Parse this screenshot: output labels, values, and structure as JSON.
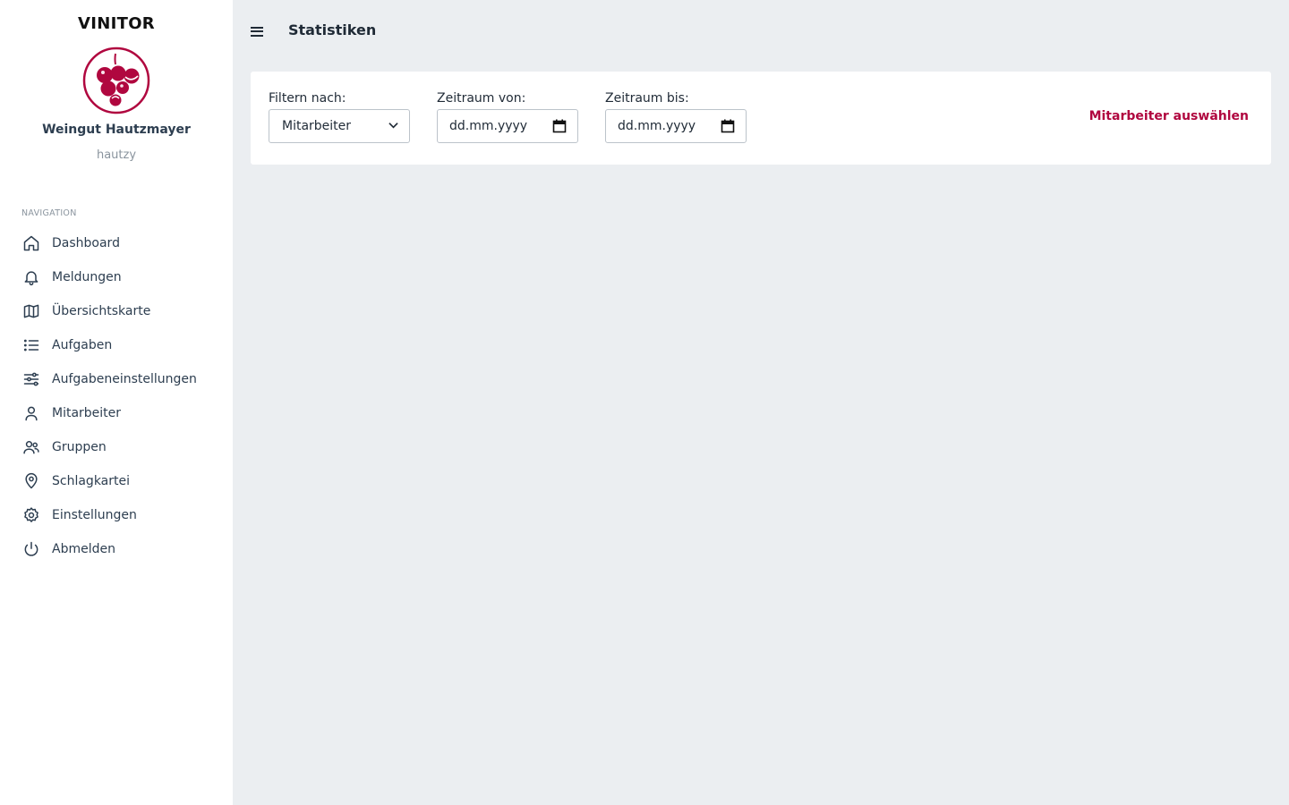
{
  "sidebar": {
    "app_name": "VINITOR",
    "company": "Weingut Hautzmayer",
    "username": "hautzy",
    "nav_title": "NAVIGATION",
    "items": [
      {
        "label": "Dashboard",
        "icon": "home-icon"
      },
      {
        "label": "Meldungen",
        "icon": "bell-icon"
      },
      {
        "label": "Übersichtskarte",
        "icon": "map-icon"
      },
      {
        "label": "Aufgaben",
        "icon": "list-icon"
      },
      {
        "label": "Aufgabeneinstellungen",
        "icon": "sliders-icon"
      },
      {
        "label": "Mitarbeiter",
        "icon": "user-icon"
      },
      {
        "label": "Gruppen",
        "icon": "users-icon"
      },
      {
        "label": "Schlagkartei",
        "icon": "map-pin-icon"
      },
      {
        "label": "Einstellungen",
        "icon": "gear-icon"
      },
      {
        "label": "Abmelden",
        "icon": "power-icon"
      }
    ]
  },
  "header": {
    "title": "Statistiken"
  },
  "filters": {
    "filter_by_label": "Filtern nach:",
    "filter_by_value": "Mitarbeiter",
    "from_label": "Zeitraum von:",
    "from_value": "dd.mm.yyyy",
    "to_label": "Zeitraum bis:",
    "to_value": "dd.mm.yyyy",
    "action_label": "Mitarbeiter auswählen"
  },
  "colors": {
    "accent": "#b0073f",
    "background": "#ebeef1",
    "sidebar": "#ffffff"
  }
}
